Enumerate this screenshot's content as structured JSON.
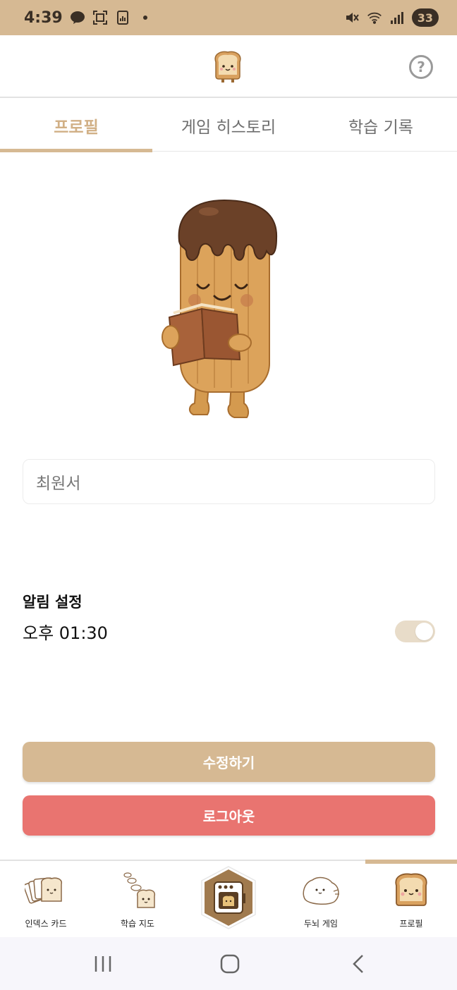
{
  "status_bar": {
    "time": "4:39",
    "battery": "33",
    "icons": [
      "kakaotalk-icon",
      "screenshot-icon",
      "chart-app-icon",
      "dot-icon",
      "mute-icon",
      "wifi-icon",
      "signal-icon"
    ]
  },
  "header": {
    "logo_icon": "toast-logo-icon",
    "help_label": "?"
  },
  "tabs": [
    {
      "label": "프로필",
      "active": true
    },
    {
      "label": "게임 히스토리",
      "active": false
    },
    {
      "label": "학습 기록",
      "active": false
    }
  ],
  "profile": {
    "character_icon": "churro-reading-book-icon",
    "name_value": "최원서"
  },
  "notification": {
    "title": "알림 설정",
    "time": "오후 01:30",
    "enabled": true
  },
  "buttons": {
    "edit": "수정하기",
    "logout": "로그아웃"
  },
  "bottom_nav": {
    "items": [
      {
        "label": "인덱스 카드",
        "icon": "bread-cards-icon"
      },
      {
        "label": "학습 지도",
        "icon": "bread-map-icon"
      },
      {
        "label": "",
        "icon": "toaster-oven-icon"
      },
      {
        "label": "두뇌 게임",
        "icon": "brain-dough-icon"
      },
      {
        "label": "프로필",
        "icon": "toast-profile-icon",
        "active": true
      }
    ]
  },
  "colors": {
    "accent": "#d6b993",
    "logout": "#e97470",
    "toggle_track": "#e8dcc9"
  }
}
